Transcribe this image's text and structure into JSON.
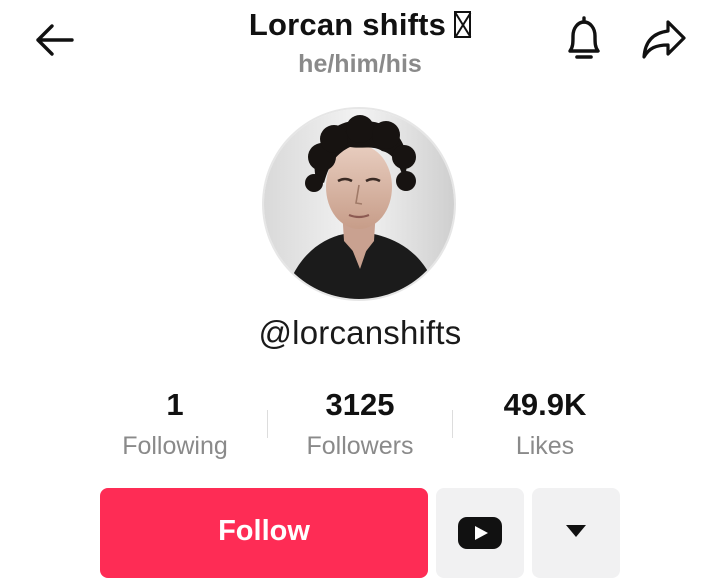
{
  "header": {
    "title": "Lorcan shifts",
    "pronouns": "he/him/his",
    "icons": {
      "back": "arrow-left-icon",
      "notifications": "bell-icon",
      "share": "share-arrow-icon"
    }
  },
  "profile": {
    "avatar": "profile-photo",
    "handle": "@lorcanshifts"
  },
  "stats": {
    "following": {
      "value": "1",
      "label": "Following"
    },
    "followers": {
      "value": "3125",
      "label": "Followers"
    },
    "likes": {
      "value": "49.9K",
      "label": "Likes"
    }
  },
  "actions": {
    "follow_label": "Follow",
    "youtube_icon": "youtube-icon",
    "more_icon": "caret-down-icon"
  },
  "colors": {
    "accent": "#fe2c55",
    "secondary_button_bg": "#f1f1f2",
    "muted_text": "#8a8a8a"
  }
}
